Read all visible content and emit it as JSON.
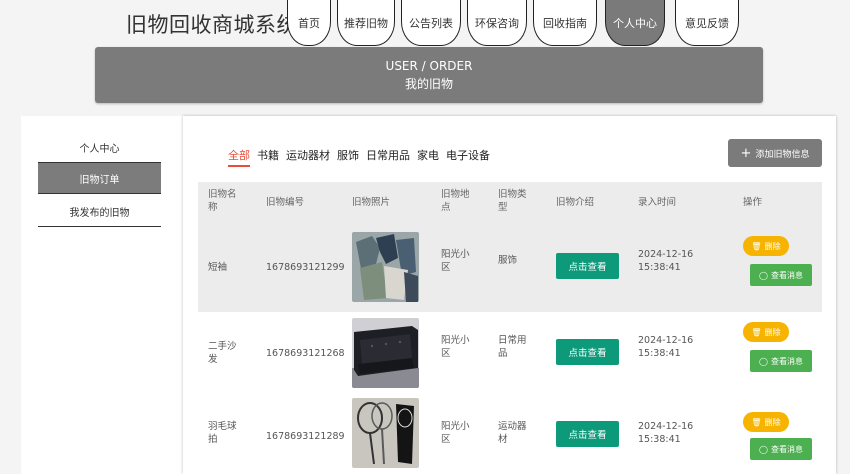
{
  "header": {
    "site_title": "旧物回收商城系统",
    "nav": [
      "首页",
      "推荐旧物",
      "公告列表",
      "环保咨询",
      "回收指南",
      "个人中心",
      "意见反馈"
    ],
    "active_nav": "个人中心"
  },
  "banner": {
    "en": "USER / ORDER",
    "cn": "我的旧物"
  },
  "sidebar": {
    "items": [
      {
        "label": "个人中心",
        "active": false
      },
      {
        "label": "旧物订单",
        "active": true
      },
      {
        "label": "我发布的旧物",
        "active": false
      }
    ]
  },
  "categories": [
    "全部",
    "书籍",
    "运动器材",
    "服饰",
    "日常用品",
    "家电",
    "电子设备"
  ],
  "active_category": "全部",
  "add_button": "添加旧物信息",
  "table": {
    "columns": [
      "旧物名称",
      "旧物编号",
      "旧物照片",
      "旧物地点",
      "旧物类型",
      "旧物介绍",
      "录入时间",
      "操作"
    ],
    "rows": [
      {
        "name": "短袖",
        "code": "1678693121299",
        "location": "阳光小区",
        "type": "服饰",
        "intro_btn": "点击查看",
        "time": "2024-12-16 15:38:41",
        "delete": "删除",
        "message": "查看消息"
      },
      {
        "name": "二手沙发",
        "code": "1678693121268",
        "location": "阳光小区",
        "type": "日常用品",
        "intro_btn": "点击查看",
        "time": "2024-12-16 15:38:41",
        "delete": "删除",
        "message": "查看消息"
      },
      {
        "name": "羽毛球拍",
        "code": "1678693121289",
        "location": "阳光小区",
        "type": "运动器材",
        "intro_btn": "点击查看",
        "time": "2024-12-16 15:38:41",
        "delete": "删除",
        "message": "查看消息"
      }
    ]
  },
  "colors": {
    "accent": "#e74c3c",
    "view_button": "#0d9a7a",
    "delete_button": "#f6b400",
    "message_button": "#4caf50",
    "gray": "#7b7b7b"
  },
  "icons": {
    "add": "plus-icon",
    "delete": "trash-icon",
    "message": "chat-icon"
  }
}
